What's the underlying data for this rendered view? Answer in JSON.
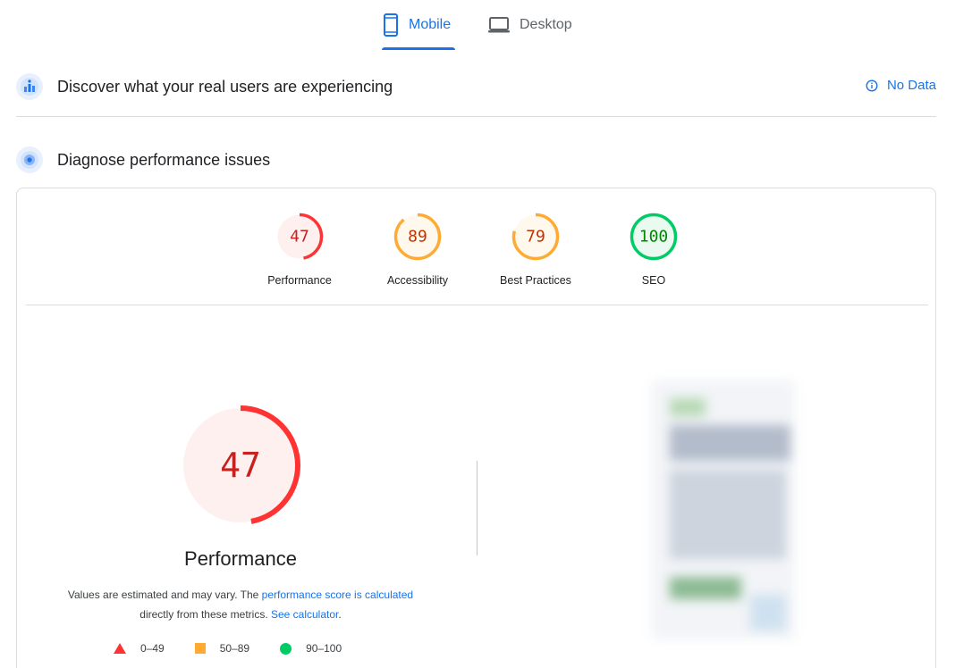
{
  "tabs": [
    {
      "label": "Mobile",
      "icon": "mobile-icon",
      "active": true
    },
    {
      "label": "Desktop",
      "icon": "desktop-icon",
      "active": false
    }
  ],
  "field_section": {
    "title": "Discover what your real users are experiencing",
    "icon": "users-chart-icon",
    "status_label": "No Data",
    "status_icon": "info-icon"
  },
  "lab_section": {
    "title": "Diagnose performance issues",
    "icon": "diagnose-icon"
  },
  "scores": [
    {
      "label": "Performance",
      "value": "47",
      "score": 47,
      "color": "#ff3333",
      "bg": "#fff0f0",
      "text_color": "#c5221f"
    },
    {
      "label": "Accessibility",
      "value": "89",
      "score": 89,
      "color": "#ffaa33",
      "bg": "#fff8ec",
      "text_color": "#c33300"
    },
    {
      "label": "Best Practices",
      "value": "79",
      "score": 79,
      "color": "#ffaa33",
      "bg": "#fff8ec",
      "text_color": "#c33300"
    },
    {
      "label": "SEO",
      "value": "100",
      "score": 100,
      "color": "#00cc66",
      "bg": "#eafaf0",
      "text_color": "#008800"
    }
  ],
  "performance_detail": {
    "value": "47",
    "score": 47,
    "label": "Performance",
    "desc_prefix": "Values are estimated and may vary. The ",
    "desc_link1": "performance score is calculated",
    "desc_middle": "directly from these metrics. ",
    "desc_link2": "See calculator",
    "desc_suffix": "."
  },
  "legend": [
    {
      "range": "0–49",
      "shape": "triangle",
      "color": "#ff3333"
    },
    {
      "range": "50–89",
      "shape": "square",
      "color": "#ffaa33"
    },
    {
      "range": "90–100",
      "shape": "circle",
      "color": "#00cc66"
    }
  ]
}
